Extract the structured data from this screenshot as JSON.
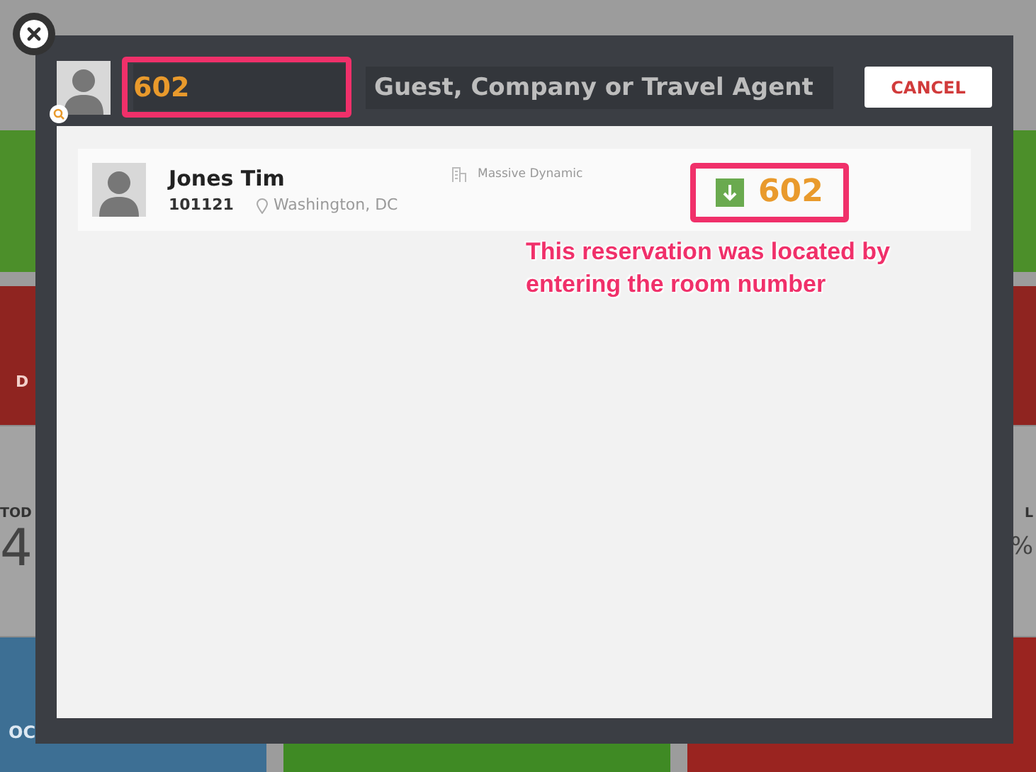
{
  "background": {
    "left_tile_letter": "D",
    "stat_left_label": "TOD",
    "stat_left_value": "4",
    "stat_right_label": "L",
    "stat_right_value": "%",
    "bottom_tile_label": "OC"
  },
  "search": {
    "room_value": "602",
    "guest_placeholder": "Guest, Company or Travel Agent"
  },
  "cancel_button": "CANCEL",
  "results": [
    {
      "name": "Jones Tim",
      "number": "101121",
      "location": "Washington, DC",
      "company": "Massive Dynamic",
      "room": "602"
    }
  ],
  "annotation": "This reservation was located by entering the room number"
}
